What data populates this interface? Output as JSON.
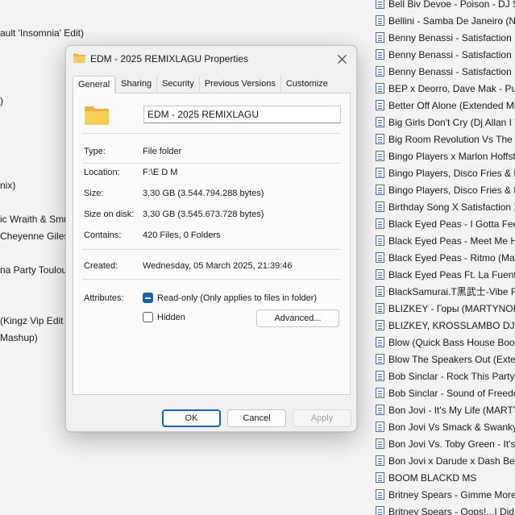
{
  "background": {
    "left_fragments": [
      "ault 'Insomnia' Edit)",
      ")",
      "nix)",
      "ic Wraith & Smu",
      "Cheyenne Giles",
      "na Party Toulou",
      "(Kingz Vip Edit",
      "Mashup)"
    ],
    "right_files": [
      "Bell Biv Devoe - Poison - DJ S",
      "Bellini - Samba De Janeiro (Ne",
      "Benny Benassi - Satisfaction (C",
      "Benny Benassi - Satisfaction (D",
      "Benny Benassi - Satisfaction (2",
      "BEP x Deorro, Dave Mak - Pun",
      "Better Off Alone (Extended Mi",
      "Big Girls Don't Cry (Dj Allan I V",
      "Big Room Revolution Vs The W",
      "Bingo Players x Marlon Hoffst",
      "Bingo Players, Disco Fries & Fa",
      "Bingo Players, Disco Fries & Fa",
      "Birthday Song X Satisfaction X",
      "Black Eyed Peas - I Gotta Feeli",
      "Black Eyed Peas - Meet Me Ha",
      "Black Eyed Peas - Ritmo (Man",
      "Black Eyed Peas Ft. La Fuente",
      "BlackSamurai.T黑武士-Vibe F",
      "BLIZKEY - Горы (MARTYNOFF",
      "BLIZKEY, KROSSLAMBO DJ - Г",
      "Blow (Quick Bass House Boot",
      "Blow The Speakers Out (Exten",
      "Bob Sinclar - Rock This Party (",
      "Bob Sinclar - Sound of Freedo",
      "Bon Jovi - It's My Life (MARTY",
      "Bon Jovi Vs Smack & Swanky",
      "Bon Jovi Vs. Toby Green - It's I",
      "Bon Jovi x Darude x Dash Berli",
      "BOOM BLACKD MS",
      "Britney Spears - Gimme More",
      "Britney Spears - Oops!...I Did I"
    ]
  },
  "dialog": {
    "title": "EDM - 2025 REMIXLAGU Properties",
    "tabs": [
      "General",
      "Sharing",
      "Security",
      "Previous Versions",
      "Customize"
    ],
    "folder_name": "EDM - 2025 REMIXLAGU",
    "type_label": "Type:",
    "type_value": "File folder",
    "location_label": "Location:",
    "location_value": "F:\\E D M",
    "size_label": "Size:",
    "size_value": "3,30 GB (3.544.794.288 bytes)",
    "size_on_disk_label": "Size on disk:",
    "size_on_disk_value": "3,30 GB (3.545.673.728 bytes)",
    "contains_label": "Contains:",
    "contains_value": "420 Files, 0 Folders",
    "created_label": "Created:",
    "created_value": "Wednesday, 05 March 2025, 21:39:46",
    "attributes_label": "Attributes:",
    "readonly_label": "Read-only (Only applies to files in folder)",
    "hidden_label": "Hidden",
    "advanced_label": "Advanced...",
    "ok_label": "OK",
    "cancel_label": "Cancel",
    "apply_label": "Apply"
  },
  "colors": {
    "accent": "#0f63b6",
    "folder": "#f3c84b"
  }
}
